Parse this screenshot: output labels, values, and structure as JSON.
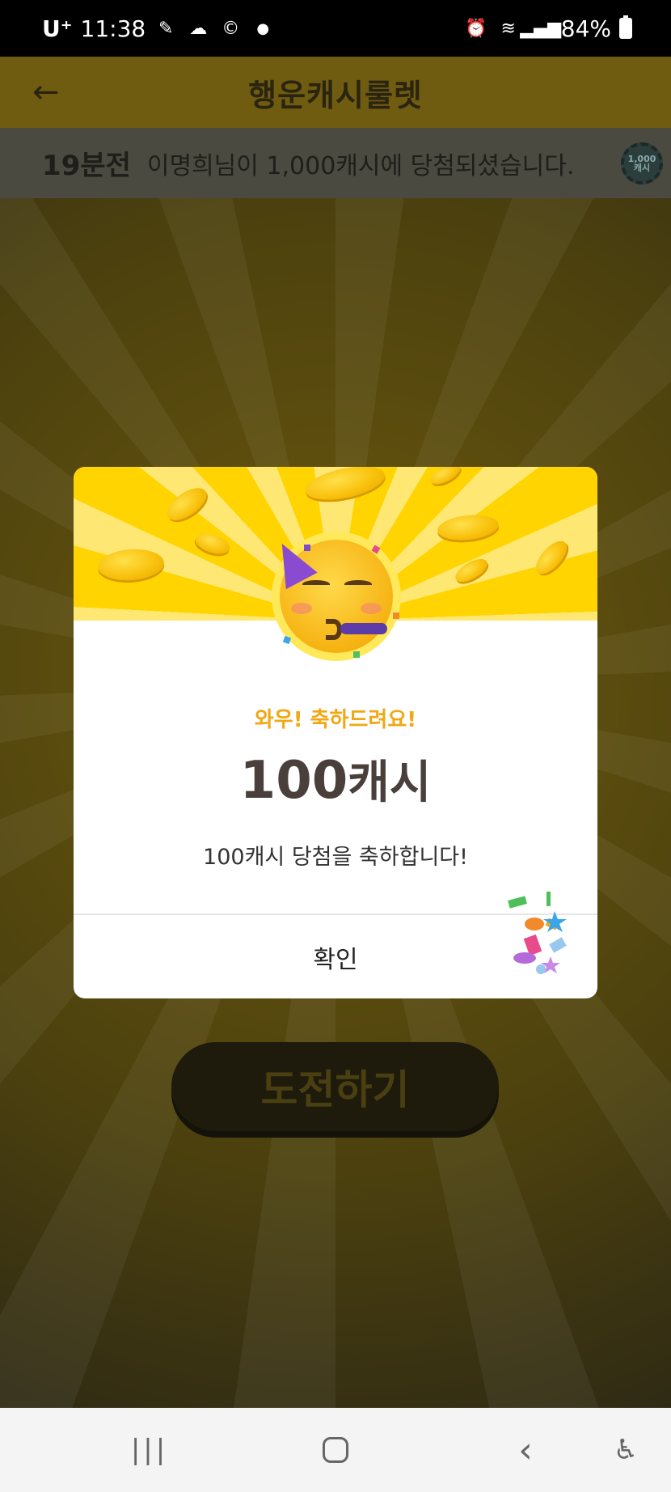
{
  "status_bar": {
    "carrier": "U⁺",
    "time": "11:38",
    "battery": "84%",
    "icons": [
      "app-notification-icon",
      "cloud-icon",
      "c-icon",
      "dot-icon",
      "alarm-icon",
      "wifi-icon",
      "signal-icon",
      "battery-icon"
    ]
  },
  "header": {
    "title": "행운캐시룰렛",
    "back_icon": "back-arrow-icon"
  },
  "ticker": {
    "time_ago": "19분전",
    "message": "이명희님이 1,000캐시에 당첨되셨습니다.",
    "chip_label": "1,000\n캐시"
  },
  "challenge_button": {
    "label": "도전하기"
  },
  "modal": {
    "subtitle": "와우! 축하드려요!",
    "amount_number": "100",
    "amount_unit": "캐시",
    "description": "100캐시 당첨을 축하합니다!",
    "confirm_label": "확인",
    "hero_icon": "party-face-emoji"
  },
  "nav_bar": {
    "recents_icon": "recents-icon",
    "home_icon": "home-icon",
    "back_icon": "back-icon",
    "accessibility_icon": "accessibility-icon"
  },
  "colors": {
    "accent_yellow": "#ffd400",
    "subtitle_orange": "#f0a814",
    "amount_text": "#4a3f3b"
  }
}
